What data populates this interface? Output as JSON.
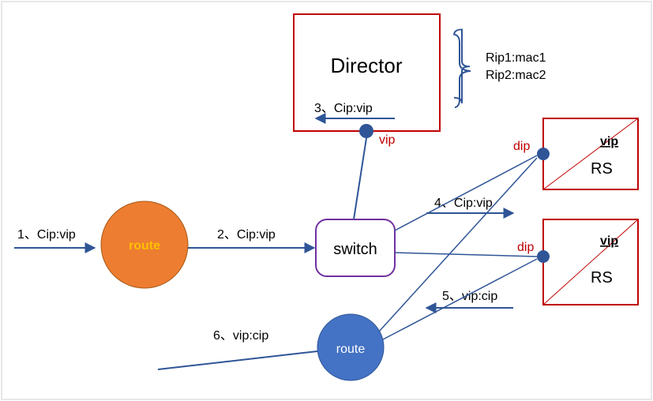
{
  "nodes": {
    "route_left_label": "route",
    "route_bottom_label": "route",
    "switch_label": "switch",
    "director_label": "Director",
    "rs1_label": "RS",
    "rs2_label": "RS",
    "vip_label_director": "vip",
    "vip_label_rs1": "vip",
    "vip_label_rs2": "vip",
    "dip_label_rs1": "dip",
    "dip_label_rs2": "dip"
  },
  "bracket_notes": {
    "line1": "Rip1:mac1",
    "line2": "Rip2:mac2"
  },
  "steps": {
    "s1": "1、Cip:vip",
    "s2": "2、Cip:vip",
    "s3": "3、Cip:vip",
    "s4": "4、Cip:vip",
    "s5": "5、vip:cip",
    "s6": "6、vip:cip"
  },
  "colors": {
    "accent_blue": "#2f5597",
    "orange": "#ed7d31",
    "circle_blue": "#4472c4",
    "red": "#c00000",
    "purple": "#7030a0"
  }
}
